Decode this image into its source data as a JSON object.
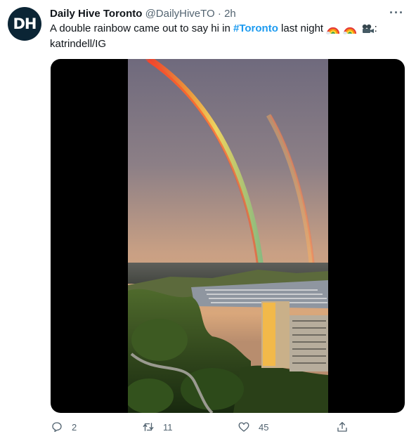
{
  "account": {
    "avatar_text": "DH",
    "name": "Daily Hive Toronto",
    "handle": "@DailyHiveTO",
    "separator": "·",
    "time": "2h"
  },
  "tweet": {
    "text_before": "A double rainbow came out to say hi in ",
    "hashtag": "#Toronto",
    "text_after": " last night",
    "credit_suffix": ":",
    "credit": "katrindell/IG",
    "emojis": [
      "rainbow-emoji",
      "rainbow-emoji",
      "movie-camera-emoji"
    ]
  },
  "actions": {
    "reply_count": "2",
    "retweet_count": "11",
    "like_count": "45"
  },
  "colors": {
    "hashtag": "#1d9bf0",
    "muted": "#536471",
    "avatar_bg": "#0b2535"
  }
}
